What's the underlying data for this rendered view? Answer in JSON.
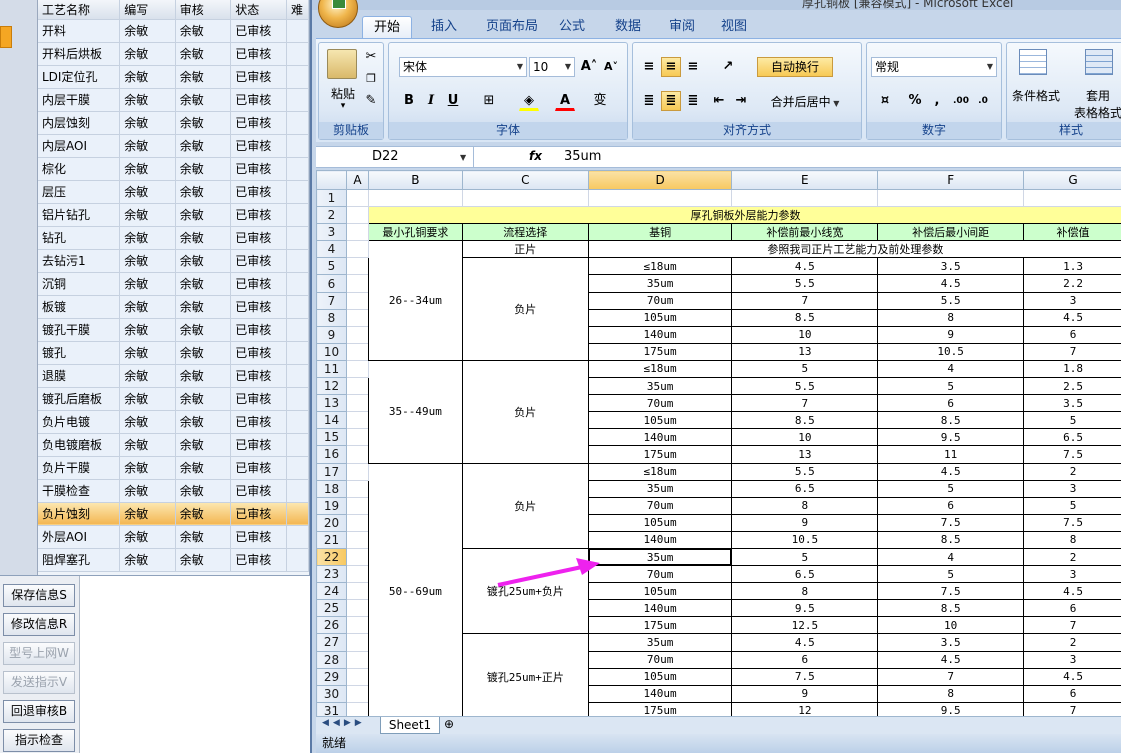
{
  "left_app": {
    "columns": [
      "工艺名称",
      "编写",
      "审核",
      "状态",
      "难"
    ],
    "rows": [
      [
        "开料",
        "余敏",
        "余敏",
        "已审核"
      ],
      [
        "开料后烘板",
        "余敏",
        "余敏",
        "已审核"
      ],
      [
        "LDI定位孔",
        "余敏",
        "余敏",
        "已审核"
      ],
      [
        "内层干膜",
        "余敏",
        "余敏",
        "已审核"
      ],
      [
        "内层蚀刻",
        "余敏",
        "余敏",
        "已审核"
      ],
      [
        "内层AOI",
        "余敏",
        "余敏",
        "已审核"
      ],
      [
        "棕化",
        "余敏",
        "余敏",
        "已审核"
      ],
      [
        "层压",
        "余敏",
        "余敏",
        "已审核"
      ],
      [
        "铝片钻孔",
        "余敏",
        "余敏",
        "已审核"
      ],
      [
        "钻孔",
        "余敏",
        "余敏",
        "已审核"
      ],
      [
        "去钻污1",
        "余敏",
        "余敏",
        "已审核"
      ],
      [
        "沉铜",
        "余敏",
        "余敏",
        "已审核"
      ],
      [
        "板镀",
        "余敏",
        "余敏",
        "已审核"
      ],
      [
        "镀孔干膜",
        "余敏",
        "余敏",
        "已审核"
      ],
      [
        "镀孔",
        "余敏",
        "余敏",
        "已审核"
      ],
      [
        "退膜",
        "余敏",
        "余敏",
        "已审核"
      ],
      [
        "镀孔后磨板",
        "余敏",
        "余敏",
        "已审核"
      ],
      [
        "负片电镀",
        "余敏",
        "余敏",
        "已审核"
      ],
      [
        "负电镀磨板",
        "余敏",
        "余敏",
        "已审核"
      ],
      [
        "负片干膜",
        "余敏",
        "余敏",
        "已审核"
      ],
      [
        "干膜检查",
        "余敏",
        "余敏",
        "已审核"
      ],
      [
        "负片蚀刻",
        "余敏",
        "余敏",
        "已审核"
      ],
      [
        "外层AOI",
        "余敏",
        "余敏",
        "已审核"
      ],
      [
        "阻焊塞孔",
        "余敏",
        "余敏",
        "已审核"
      ]
    ],
    "highlighted_row": 21,
    "buttons": [
      {
        "label": "保存信息S",
        "enabled": true
      },
      {
        "label": "修改信息R",
        "enabled": true
      },
      {
        "label": "型号上网W",
        "enabled": false
      },
      {
        "label": "发送指示V",
        "enabled": false
      },
      {
        "label": "回退审核B",
        "enabled": true
      },
      {
        "label": "指示检查",
        "enabled": true
      }
    ]
  },
  "excel": {
    "title": "厚孔铜板 [兼容模式] - Microsoft Excel",
    "tabs": [
      "开始",
      "插入",
      "页面布局",
      "公式",
      "数据",
      "审阅",
      "视图"
    ],
    "font_name": "宋体",
    "font_size": "10",
    "wrap_text": "自动换行",
    "merge_center": "合并后居中",
    "number_format": "常规",
    "groups": {
      "clipboard": "剪贴板",
      "font": "字体",
      "alignment": "对齐方式",
      "number": "数字",
      "styles": "样式"
    },
    "paste": "粘贴",
    "cond_format": "条件格式",
    "table_format_1": "套用",
    "table_format_2": "表格格式",
    "cell_ref": "D22",
    "fx": "fx",
    "formula": "35um",
    "sheet_tab": "Sheet1",
    "status": "就绪"
  },
  "sheet": {
    "col_headers": [
      "A",
      "B",
      "C",
      "D",
      "E",
      "F",
      "G"
    ],
    "row_numbers": [
      "1",
      "2",
      "3",
      "4",
      "5",
      "6",
      "7",
      "8",
      "9",
      "10",
      "11",
      "12",
      "13",
      "14",
      "15",
      "16",
      "17",
      "18",
      "19",
      "20",
      "21",
      "22",
      "23",
      "24",
      "25",
      "26",
      "27",
      "28",
      "29",
      "30",
      "31"
    ],
    "title": "厚孔铜板外层能力参数",
    "headers": [
      "最小孔铜要求",
      "流程选择",
      "基铜",
      "补偿前最小线宽",
      "补偿后最小间距",
      "补偿值"
    ],
    "row4_flow": "正片",
    "row4_note": "参照我司正片工艺能力及前处理参数",
    "groups": [
      {
        "label": "26--34um",
        "rows": 6,
        "flows": [
          {
            "label": "负片",
            "rows": 6
          }
        ]
      },
      {
        "label": "35--49um",
        "rows": 6,
        "flows": [
          {
            "label": "负片",
            "rows": 6
          }
        ]
      },
      {
        "label": "50--69um",
        "rows": 15,
        "flows": [
          {
            "label": "负片",
            "rows": 5
          },
          {
            "label": "镀孔25um+负片",
            "rows": 5
          },
          {
            "label": "镀孔25um+正片",
            "rows": 5
          }
        ]
      }
    ],
    "data_rows": [
      [
        "≤18um",
        "4.5",
        "3.5",
        "1.3"
      ],
      [
        "35um",
        "5.5",
        "4.5",
        "2.2"
      ],
      [
        "70um",
        "7",
        "5.5",
        "3"
      ],
      [
        "105um",
        "8.5",
        "8",
        "4.5"
      ],
      [
        "140um",
        "10",
        "9",
        "6"
      ],
      [
        "175um",
        "13",
        "10.5",
        "7"
      ],
      [
        "≤18um",
        "5",
        "4",
        "1.8"
      ],
      [
        "35um",
        "5.5",
        "5",
        "2.5"
      ],
      [
        "70um",
        "7",
        "6",
        "3.5"
      ],
      [
        "105um",
        "8.5",
        "8.5",
        "5"
      ],
      [
        "140um",
        "10",
        "9.5",
        "6.5"
      ],
      [
        "175um",
        "13",
        "11",
        "7.5"
      ],
      [
        "≤18um",
        "5.5",
        "4.5",
        "2"
      ],
      [
        "35um",
        "6.5",
        "5",
        "3"
      ],
      [
        "70um",
        "8",
        "6",
        "5"
      ],
      [
        "105um",
        "9",
        "7.5",
        "7.5"
      ],
      [
        "140um",
        "10.5",
        "8.5",
        "8"
      ],
      [
        "35um",
        "5",
        "4",
        "2"
      ],
      [
        "70um",
        "6.5",
        "5",
        "3"
      ],
      [
        "105um",
        "8",
        "7.5",
        "4.5"
      ],
      [
        "140um",
        "9.5",
        "8.5",
        "6"
      ],
      [
        "175um",
        "12.5",
        "10",
        "7"
      ],
      [
        "35um",
        "4.5",
        "3.5",
        "2"
      ],
      [
        "70um",
        "6",
        "4.5",
        "3"
      ],
      [
        "105um",
        "7.5",
        "7",
        "4.5"
      ],
      [
        "140um",
        "9",
        "8",
        "6"
      ],
      [
        "175um",
        "12",
        "9.5",
        "7"
      ]
    ],
    "arrow_color": "#ee22ee"
  }
}
